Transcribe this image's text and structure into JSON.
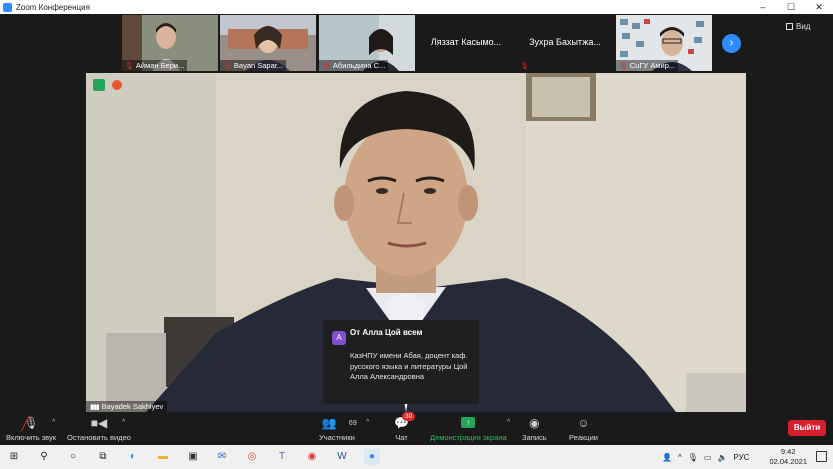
{
  "window": {
    "title": "Zoom Конференция",
    "controls": [
      "–",
      "☐",
      "✕"
    ]
  },
  "gallery": {
    "participants": [
      {
        "name": "Айман Бери..."
      },
      {
        "name": "Bayan Sapar..."
      },
      {
        "name": "Абильдина С..."
      },
      {
        "name": "Ляззат Касымо..."
      },
      {
        "name": "Зухра Бахытжа..."
      },
      {
        "name": "СuГУ Амир..."
      }
    ],
    "view_label": "Вид",
    "next_icon": "chevron-right-icon"
  },
  "main_video": {
    "speaker": "Bayadek Sakhiyev"
  },
  "chat_toast": {
    "avatar_letter": "A",
    "header": "От Алла Цой всем",
    "message": "КазНПУ имени Абая, доцент каф. русского языка и литературы Цой Алла Александровна"
  },
  "toolbar": {
    "unmute": "Включить звук",
    "stop_video": "Остановить видео",
    "participants": "Участники",
    "participants_count": "69",
    "chat": "Чат",
    "chat_badge": "30",
    "share": "Демонстрация экрана",
    "record": "Запись",
    "reactions": "Реакции",
    "leave": "Выйти"
  },
  "taskbar": {
    "language": "РУС",
    "time": "9:42",
    "date": "02.04.2021"
  },
  "colors": {
    "accent": "#2d8cff",
    "share_green": "#23a55a",
    "leave_red": "#d3202c"
  }
}
